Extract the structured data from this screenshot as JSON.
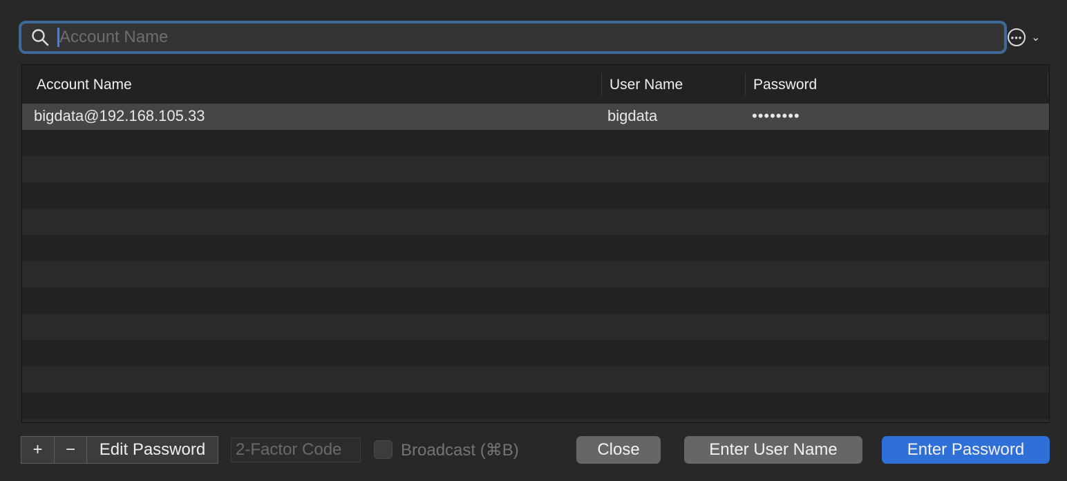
{
  "search": {
    "placeholder": "Account Name",
    "value": ""
  },
  "table": {
    "columns": [
      "Account Name",
      "User Name",
      "Password"
    ],
    "rows": [
      {
        "account": "bigdata@192.168.105.33",
        "user": "bigdata",
        "password": "••••••••"
      }
    ]
  },
  "footer": {
    "add": "+",
    "remove": "−",
    "edit_password": "Edit Password",
    "two_factor_placeholder": "2-Factor Code",
    "broadcast": "Broadcast (⌘B)",
    "close": "Close",
    "enter_user": "Enter User Name",
    "enter_password": "Enter Password"
  },
  "colors": {
    "accent": "#2f6fd8",
    "focus_ring": "#3d6a99"
  }
}
